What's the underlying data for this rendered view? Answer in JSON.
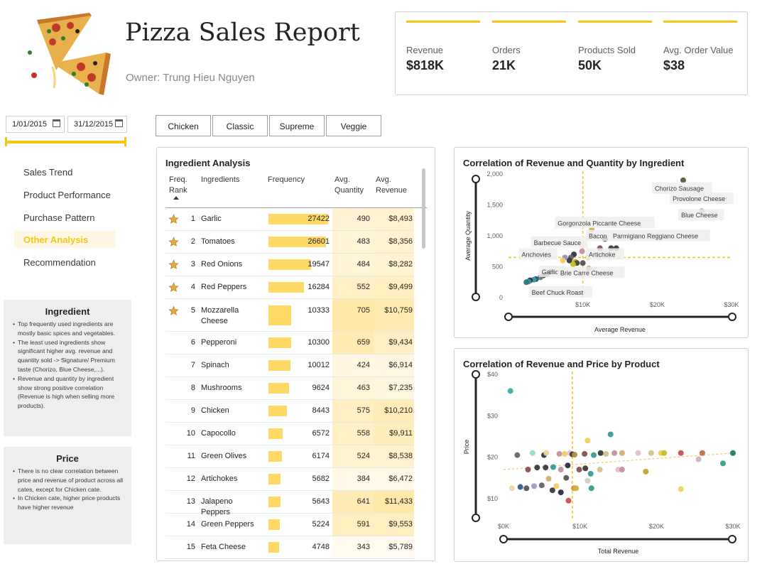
{
  "header": {
    "title": "Pizza Sales Report",
    "owner": "Owner: Trung Hieu Nguyen"
  },
  "kpis": [
    {
      "label": "Revenue",
      "value": "$818K"
    },
    {
      "label": "Orders",
      "value": "21K"
    },
    {
      "label": "Products Sold",
      "value": "50K"
    },
    {
      "label": "Avg. Order Value",
      "value": "$38"
    }
  ],
  "date_slicer": {
    "start": "1/01/2015",
    "end": "31/12/2015"
  },
  "nav": [
    {
      "label": "Sales Trend",
      "active": false
    },
    {
      "label": "Product Performance",
      "active": false
    },
    {
      "label": "Purchase Pattern",
      "active": false
    },
    {
      "label": "Other Analysis",
      "active": true
    },
    {
      "label": "Recommendation",
      "active": false
    }
  ],
  "notes": {
    "ingredient": {
      "title": "Ingredient",
      "bullets": [
        "Top frequently used ingredients are mostly basic spices and vegetables.",
        "The least used ingredients show significant higher avg. revenue and quantity sold -> Signature/ Premium taste (Chorizo, Blue Cheese,...).",
        "Revenue and quantity by ingredient show strong positive correlation (Revenue is high when selling more products)."
      ]
    },
    "price": {
      "title": "Price",
      "bullets": [
        "There is no clear correlation between price and revenue of product across all cates, except for Chicken cate.",
        "In Chicken cate, higher price products have higher revenue"
      ]
    }
  },
  "categories": [
    "Chicken",
    "Classic",
    "Supreme",
    "Veggie"
  ],
  "ingredient_table": {
    "title": "Ingredient Analysis",
    "headers": {
      "rank": "Freq. Rank",
      "ingredient": "Ingredients",
      "frequency": "Frequency",
      "avg_qty": "Avg. Quantity",
      "avg_rev": "Avg. Revenue"
    },
    "max_frequency": 27422,
    "rows": [
      {
        "rank": "1",
        "ingredient": "Garlic",
        "frequency": 27422,
        "frequency_text": "27422",
        "avg_qty": 490,
        "avg_qty_text": "490",
        "avg_rev": "$8,493",
        "star": true
      },
      {
        "rank": "2",
        "ingredient": "Tomatoes",
        "frequency": 26601,
        "frequency_text": "26601",
        "avg_qty": 483,
        "avg_qty_text": "483",
        "avg_rev": "$8,356",
        "star": true
      },
      {
        "rank": "3",
        "ingredient": "Red Onions",
        "frequency": 19547,
        "frequency_text": "19547",
        "avg_qty": 484,
        "avg_qty_text": "484",
        "avg_rev": "$8,282",
        "star": true
      },
      {
        "rank": "4",
        "ingredient": "Red Peppers",
        "frequency": 16284,
        "frequency_text": "16284",
        "avg_qty": 552,
        "avg_qty_text": "552",
        "avg_rev": "$9,499",
        "star": true
      },
      {
        "rank": "5",
        "ingredient": "Mozzarella Cheese",
        "frequency": 10333,
        "frequency_text": "10333",
        "avg_qty": 705,
        "avg_qty_text": "705",
        "avg_rev": "$10,759",
        "star": true
      },
      {
        "rank": "6",
        "ingredient": "Pepperoni",
        "frequency": 10300,
        "frequency_text": "10300",
        "avg_qty": 659,
        "avg_qty_text": "659",
        "avg_rev": "$9,434",
        "star": false
      },
      {
        "rank": "7",
        "ingredient": "Spinach",
        "frequency": 10012,
        "frequency_text": "10012",
        "avg_qty": 424,
        "avg_qty_text": "424",
        "avg_rev": "$6,914",
        "star": false
      },
      {
        "rank": "8",
        "ingredient": "Mushrooms",
        "frequency": 9624,
        "frequency_text": "9624",
        "avg_qty": 463,
        "avg_qty_text": "463",
        "avg_rev": "$7,235",
        "star": false
      },
      {
        "rank": "9",
        "ingredient": "Chicken",
        "frequency": 8443,
        "frequency_text": "8443",
        "avg_qty": 575,
        "avg_qty_text": "575",
        "avg_rev": "$10,210",
        "star": false
      },
      {
        "rank": "10",
        "ingredient": "Capocollo",
        "frequency": 6572,
        "frequency_text": "6572",
        "avg_qty": 558,
        "avg_qty_text": "558",
        "avg_rev": "$9,911",
        "star": false
      },
      {
        "rank": "11",
        "ingredient": "Green Olives",
        "frequency": 6174,
        "frequency_text": "6174",
        "avg_qty": 524,
        "avg_qty_text": "524",
        "avg_rev": "$8,538",
        "star": false
      },
      {
        "rank": "12",
        "ingredient": "Artichokes",
        "frequency": 5682,
        "frequency_text": "5682",
        "avg_qty": 384,
        "avg_qty_text": "384",
        "avg_rev": "$6,472",
        "star": false
      },
      {
        "rank": "13",
        "ingredient": "Jalapeno Peppers",
        "frequency": 5643,
        "frequency_text": "5643",
        "avg_qty": 641,
        "avg_qty_text": "641",
        "avg_rev": "$11,433",
        "star": false
      },
      {
        "rank": "14",
        "ingredient": "Green Peppers",
        "frequency": 5224,
        "frequency_text": "5224",
        "avg_qty": 591,
        "avg_qty_text": "591",
        "avg_rev": "$9,553",
        "star": false
      },
      {
        "rank": "15",
        "ingredient": "Feta Cheese",
        "frequency": 4748,
        "frequency_text": "4748",
        "avg_qty": 343,
        "avg_qty_text": "343",
        "avg_rev": "$5,789",
        "star": false
      }
    ]
  },
  "colors": {
    "accent": "#f5c518",
    "bar": "#ffd966",
    "star": "#e6a93c",
    "cell_max": "#ffe8a8",
    "cell_min": "#fffbf0"
  },
  "chart_data": [
    {
      "type": "scatter",
      "title": "Correlation of Revenue and Quantity by Ingredient",
      "xlabel": "Average Revenue",
      "ylabel": "Average Quantity",
      "xlim": [
        0,
        30000
      ],
      "ylim": [
        0,
        2000
      ],
      "x_ticks": [
        {
          "v": 10000,
          "label": "$10K"
        },
        {
          "v": 20000,
          "label": "$20K"
        },
        {
          "v": 30000,
          "label": "$30K"
        }
      ],
      "y_ticks": [
        {
          "v": 0,
          "label": "0"
        },
        {
          "v": 500,
          "label": "500"
        },
        {
          "v": 1000,
          "label": "1,000"
        },
        {
          "v": 1500,
          "label": "1,500"
        },
        {
          "v": 2000,
          "label": "2,000"
        }
      ],
      "avg_x": 10000,
      "avg_y": 650,
      "points": [
        {
          "x": 23500,
          "y": 1900,
          "c": "#5c5a30",
          "label": "Chorizo Sausage"
        },
        {
          "x": 26000,
          "y": 1400,
          "c": "#a08aa0",
          "label": "Blue Cheese"
        },
        {
          "x": 11200,
          "y": 1100,
          "c": "#c8a030",
          "label": "Gorgonzola Piccante Cheese"
        },
        {
          "x": 12900,
          "y": 950,
          "c": "#d0b070",
          "label": "Bacon"
        },
        {
          "x": 13000,
          "y": 950,
          "c": "#3a3a3a",
          "label": ""
        },
        {
          "x": 14500,
          "y": 800,
          "c": "#3a3a3a",
          "label": ""
        },
        {
          "x": 13800,
          "y": 800,
          "c": "#3a3a3a",
          "label": ""
        },
        {
          "x": 12300,
          "y": 800,
          "c": "#8a5050",
          "label": ""
        },
        {
          "x": 9900,
          "y": 750,
          "c": "#c890a0",
          "label": ""
        },
        {
          "x": 8800,
          "y": 700,
          "c": "#333344",
          "label": ""
        },
        {
          "x": 8400,
          "y": 650,
          "c": "#666666",
          "label": ""
        },
        {
          "x": 7600,
          "y": 650,
          "c": "#9090c0",
          "label": ""
        },
        {
          "x": 10700,
          "y": 650,
          "c": "#d4c090",
          "label": ""
        },
        {
          "x": 7300,
          "y": 600,
          "c": "#f0d060",
          "label": ""
        },
        {
          "x": 8200,
          "y": 600,
          "c": "#3a3a3a",
          "label": ""
        },
        {
          "x": 9000,
          "y": 580,
          "c": "#cfa030",
          "label": ""
        },
        {
          "x": 9200,
          "y": 560,
          "c": "#444444",
          "label": ""
        },
        {
          "x": 10000,
          "y": 560,
          "c": "#555555",
          "label": ""
        },
        {
          "x": 8700,
          "y": 540,
          "c": "#c8c020",
          "label": ""
        },
        {
          "x": 10800,
          "y": 470,
          "c": "#b09040",
          "label": ""
        },
        {
          "x": 7000,
          "y": 450,
          "c": "#2a8a80",
          "label": ""
        },
        {
          "x": 5700,
          "y": 420,
          "c": "#333333",
          "label": ""
        },
        {
          "x": 5200,
          "y": 380,
          "c": "#555555",
          "label": ""
        },
        {
          "x": 4700,
          "y": 360,
          "c": "#3a3a3a",
          "label": ""
        },
        {
          "x": 4300,
          "y": 330,
          "c": "#777777",
          "label": ""
        },
        {
          "x": 3700,
          "y": 300,
          "c": "#1a5080",
          "label": ""
        },
        {
          "x": 3400,
          "y": 290,
          "c": "#3a9a90",
          "label": ""
        },
        {
          "x": 2900,
          "y": 280,
          "c": "#2a2a50",
          "label": ""
        },
        {
          "x": 2700,
          "y": 260,
          "c": "#4a8aa0",
          "label": ""
        },
        {
          "x": 2400,
          "y": 250,
          "c": "#2a7a70",
          "label": ""
        }
      ],
      "annotations": [
        {
          "text": "Provolone Cheese"
        },
        {
          "text": "Parmigiano Reggiano Cheese"
        },
        {
          "text": "Barbecue Sauce"
        },
        {
          "text": "Anchovies"
        },
        {
          "text": "Artichoke"
        },
        {
          "text": "Garlic"
        },
        {
          "text": "Brie Carre Cheese"
        },
        {
          "text": "Beef Chuck Roast"
        }
      ]
    },
    {
      "type": "scatter",
      "title": "Correlation of Revenue and Price by Product",
      "xlabel": "Total Revenue",
      "ylabel": "Price",
      "xlim": [
        0,
        30000
      ],
      "ylim": [
        5,
        40
      ],
      "x_ticks": [
        {
          "v": 0,
          "label": "$0K"
        },
        {
          "v": 10000,
          "label": "$10K"
        },
        {
          "v": 20000,
          "label": "$20K"
        },
        {
          "v": 30000,
          "label": "$30K"
        }
      ],
      "y_ticks": [
        {
          "v": 10,
          "label": "$10"
        },
        {
          "v": 20,
          "label": "$20"
        },
        {
          "v": 30,
          "label": "$30"
        },
        {
          "v": 40,
          "label": "$40"
        }
      ],
      "avg_x": 9000,
      "trend": [
        {
          "x": 0,
          "y": 17
        },
        {
          "x": 30000,
          "y": 21
        }
      ],
      "points": [
        {
          "x": 900,
          "y": 36,
          "c": "#3fb0a8"
        },
        {
          "x": 14000,
          "y": 25.5,
          "c": "#3a9a90"
        },
        {
          "x": 11000,
          "y": 24,
          "c": "#f0d060"
        },
        {
          "x": 1800,
          "y": 20.5,
          "c": "#666666"
        },
        {
          "x": 3800,
          "y": 21,
          "c": "#a0d8d0"
        },
        {
          "x": 5300,
          "y": 20.5,
          "c": "#3a3a3a"
        },
        {
          "x": 5600,
          "y": 21,
          "c": "#e8d8a0"
        },
        {
          "x": 7300,
          "y": 20.8,
          "c": "#c890a0"
        },
        {
          "x": 8000,
          "y": 20.8,
          "c": "#f0d060"
        },
        {
          "x": 8700,
          "y": 21,
          "c": "#e0c0d0"
        },
        {
          "x": 9000,
          "y": 20.7,
          "c": "#3a3a3a"
        },
        {
          "x": 9300,
          "y": 20.6,
          "c": "#b09040"
        },
        {
          "x": 10600,
          "y": 20.8,
          "c": "#8a5050"
        },
        {
          "x": 11800,
          "y": 20.5,
          "c": "#3a9a90"
        },
        {
          "x": 12700,
          "y": 21,
          "c": "#3a3a3a"
        },
        {
          "x": 13400,
          "y": 20.8,
          "c": "#d4c090"
        },
        {
          "x": 14500,
          "y": 21,
          "c": "#c890a0"
        },
        {
          "x": 15500,
          "y": 21,
          "c": "#d0b070"
        },
        {
          "x": 17600,
          "y": 21,
          "c": "#e0c0d0"
        },
        {
          "x": 19300,
          "y": 21,
          "c": "#d4c090"
        },
        {
          "x": 20600,
          "y": 21,
          "c": "#f0d060"
        },
        {
          "x": 21000,
          "y": 21,
          "c": "#c8c020"
        },
        {
          "x": 23200,
          "y": 21,
          "c": "#c85050"
        },
        {
          "x": 25500,
          "y": 19.5,
          "c": "#d0b0c0"
        },
        {
          "x": 26000,
          "y": 21,
          "c": "#c07050"
        },
        {
          "x": 28700,
          "y": 18.5,
          "c": "#3a9a90"
        },
        {
          "x": 30000,
          "y": 21,
          "c": "#2a7a60"
        },
        {
          "x": 3200,
          "y": 17,
          "c": "#8a5050"
        },
        {
          "x": 4400,
          "y": 17.5,
          "c": "#3a3a3a"
        },
        {
          "x": 5500,
          "y": 17.5,
          "c": "#3a3a3a"
        },
        {
          "x": 6500,
          "y": 17.6,
          "c": "#3a9a90"
        },
        {
          "x": 7500,
          "y": 17,
          "c": "#c890a0"
        },
        {
          "x": 8400,
          "y": 18,
          "c": "#2a2a50"
        },
        {
          "x": 9900,
          "y": 17,
          "c": "#8a5050"
        },
        {
          "x": 10700,
          "y": 17.3,
          "c": "#3a3a3a"
        },
        {
          "x": 11400,
          "y": 16,
          "c": "#3a9a90"
        },
        {
          "x": 12600,
          "y": 17,
          "c": "#d4c090"
        },
        {
          "x": 15000,
          "y": 17,
          "c": "#e0c0d0"
        },
        {
          "x": 15500,
          "y": 17,
          "c": "#c890a0"
        },
        {
          "x": 18600,
          "y": 16.5,
          "c": "#c8a030"
        },
        {
          "x": 1100,
          "y": 12.5,
          "c": "#e8d8a0"
        },
        {
          "x": 2200,
          "y": 12.8,
          "c": "#3a5a80"
        },
        {
          "x": 3000,
          "y": 12.5,
          "c": "#555555"
        },
        {
          "x": 4000,
          "y": 13,
          "c": "#a0a0c0"
        },
        {
          "x": 5000,
          "y": 13.2,
          "c": "#666666"
        },
        {
          "x": 5900,
          "y": 14.8,
          "c": "#d0b070"
        },
        {
          "x": 6400,
          "y": 12,
          "c": "#3a3a3a"
        },
        {
          "x": 6900,
          "y": 13,
          "c": "#f0d060"
        },
        {
          "x": 7500,
          "y": 11.5,
          "c": "#2a2a50"
        },
        {
          "x": 8200,
          "y": 15,
          "c": "#555555"
        },
        {
          "x": 9200,
          "y": 12.5,
          "c": "#c8a030"
        },
        {
          "x": 9500,
          "y": 12.5,
          "c": "#d4b040"
        },
        {
          "x": 11000,
          "y": 14.3,
          "c": "#d0d0c0"
        },
        {
          "x": 11500,
          "y": 12.5,
          "c": "#3a9a90"
        },
        {
          "x": 23200,
          "y": 12.3,
          "c": "#f0d060"
        },
        {
          "x": 8500,
          "y": 9.5,
          "c": "#c85050"
        }
      ]
    }
  ]
}
